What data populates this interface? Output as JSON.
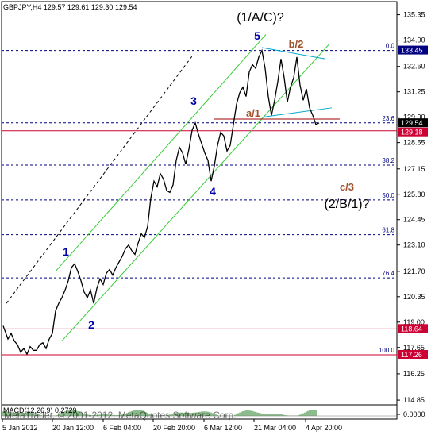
{
  "header": {
    "symbol_line": "GBPJPY,H4  129.57 129.61 129.30 129.54"
  },
  "watermark": "MetaTrader, © 2001-2012, MetaQuotes Software Corp.",
  "indicator_label": "MACD(12,26,9) 0.2729",
  "colors": {
    "background": "#ffffff",
    "price": "#000000",
    "channel": "#33cc33",
    "channel_dashed": "#000000",
    "fib_line": "#000080",
    "red_line": "#cc0033",
    "wave_blue": "#0000aa",
    "wave_brown": "#a0522d",
    "triangle": "#00aacc",
    "price_box_black": "#000000",
    "price_box_red": "#cc0033",
    "price_box_blue": "#000080"
  },
  "chart_data": {
    "type": "line",
    "title": "",
    "price_axis": {
      "labels": [
        "135.35",
        "134.00",
        "132.60",
        "131.25",
        "129.90",
        "128.55",
        "127.15",
        "125.80",
        "124.45",
        "123.10",
        "121.70",
        "120.35",
        "119.00",
        "117.65",
        "116.25",
        "114.85",
        "0.0000"
      ],
      "min": 114.6,
      "max": 136.05
    },
    "time_axis": {
      "labels": [
        "5 Jan 2012",
        "20 Jan 12:00",
        "6 Feb 04:00",
        "20 Feb 20:00",
        "6 Mar 12:00",
        "21 Mar 04:00",
        "4 Apr 20:00"
      ]
    },
    "price_boxes": [
      {
        "value": "133.45",
        "color": "blue"
      },
      {
        "value": "129.54",
        "color": "black"
      },
      {
        "value": "129.18",
        "color": "red"
      },
      {
        "value": "118.64",
        "color": "red"
      },
      {
        "value": "117.26",
        "color": "red"
      }
    ],
    "fib_levels": [
      {
        "label": "0.0",
        "price": 133.45
      },
      {
        "label": "23.6",
        "price": 129.6
      },
      {
        "label": "38.2",
        "price": 127.35
      },
      {
        "label": "50.0",
        "price": 125.5
      },
      {
        "label": "61.8",
        "price": 123.65
      },
      {
        "label": "76.4",
        "price": 121.35
      },
      {
        "label": "100.0",
        "price": 117.26
      }
    ],
    "horizontal_lines": [
      {
        "price": 129.18,
        "color": "red"
      },
      {
        "price": 118.64,
        "color": "red"
      },
      {
        "price": 117.26,
        "color": "red"
      }
    ],
    "wave_labels": [
      {
        "text": "1",
        "color": "blue"
      },
      {
        "text": "2",
        "color": "blue"
      },
      {
        "text": "3",
        "color": "blue"
      },
      {
        "text": "4",
        "color": "blue"
      },
      {
        "text": "5",
        "color": "blue"
      },
      {
        "text": "a/1",
        "color": "brown"
      },
      {
        "text": "b/2",
        "color": "brown"
      },
      {
        "text": "c/3",
        "color": "brown"
      },
      {
        "text": "(1/A/C)?",
        "color": "black"
      },
      {
        "text": "(2/B/1)?",
        "color": "black"
      }
    ],
    "series": [
      {
        "points": [
          [
            0,
            118.8
          ],
          [
            6,
            118.1
          ],
          [
            10,
            118.4
          ],
          [
            14,
            118.0
          ],
          [
            18,
            117.8
          ],
          [
            22,
            117.4
          ],
          [
            26,
            117.6
          ],
          [
            30,
            117.3
          ],
          [
            34,
            117.7
          ],
          [
            38,
            117.5
          ],
          [
            42,
            117.5
          ],
          [
            46,
            117.8
          ],
          [
            50,
            117.9
          ],
          [
            54,
            117.6
          ],
          [
            58,
            118.1
          ],
          [
            62,
            118.4
          ],
          [
            66,
            119.6
          ],
          [
            70,
            120.0
          ],
          [
            74,
            120.3
          ],
          [
            78,
            120.7
          ],
          [
            82,
            121.2
          ],
          [
            86,
            121.9
          ],
          [
            90,
            122.1
          ],
          [
            94,
            121.7
          ],
          [
            98,
            121.2
          ],
          [
            102,
            120.6
          ],
          [
            106,
            120.3
          ],
          [
            110,
            120.7
          ],
          [
            114,
            120.0
          ],
          [
            118,
            120.8
          ],
          [
            122,
            121.3
          ],
          [
            126,
            121.0
          ],
          [
            130,
            121.6
          ],
          [
            134,
            121.8
          ],
          [
            138,
            121.5
          ],
          [
            142,
            121.9
          ],
          [
            146,
            122.2
          ],
          [
            150,
            122.5
          ],
          [
            154,
            122.9
          ],
          [
            158,
            123.1
          ],
          [
            162,
            122.8
          ],
          [
            166,
            122.6
          ],
          [
            170,
            123.2
          ],
          [
            174,
            123.7
          ],
          [
            178,
            123.5
          ],
          [
            182,
            124.1
          ],
          [
            186,
            125.6
          ],
          [
            190,
            126.5
          ],
          [
            194,
            126.2
          ],
          [
            198,
            126.9
          ],
          [
            202,
            126.6
          ],
          [
            206,
            126.0
          ],
          [
            210,
            125.9
          ],
          [
            214,
            126.3
          ],
          [
            218,
            127.6
          ],
          [
            222,
            128.3
          ],
          [
            226,
            128.0
          ],
          [
            230,
            127.4
          ],
          [
            234,
            128.2
          ],
          [
            238,
            129.2
          ],
          [
            242,
            129.6
          ],
          [
            246,
            129.0
          ],
          [
            250,
            128.5
          ],
          [
            254,
            128.0
          ],
          [
            258,
            127.6
          ],
          [
            262,
            126.5
          ],
          [
            266,
            127.3
          ],
          [
            270,
            128.4
          ],
          [
            274,
            129.1
          ],
          [
            278,
            128.9
          ],
          [
            282,
            128.1
          ],
          [
            286,
            128.4
          ],
          [
            290,
            129.5
          ],
          [
            294,
            130.6
          ],
          [
            298,
            131.2
          ],
          [
            302,
            131.5
          ],
          [
            306,
            131.0
          ],
          [
            310,
            132.3
          ],
          [
            314,
            132.7
          ],
          [
            318,
            132.5
          ],
          [
            322,
            133.1
          ],
          [
            326,
            133.45
          ],
          [
            330,
            132.5
          ],
          [
            334,
            131.0
          ],
          [
            338,
            130.0
          ],
          [
            342,
            130.8
          ],
          [
            346,
            131.8
          ],
          [
            350,
            133.0
          ],
          [
            354,
            132.0
          ],
          [
            358,
            130.7
          ],
          [
            362,
            131.5
          ],
          [
            366,
            132.0
          ],
          [
            370,
            133.1
          ],
          [
            374,
            131.6
          ],
          [
            378,
            130.8
          ],
          [
            382,
            131.4
          ],
          [
            386,
            130.4
          ],
          [
            390,
            130.0
          ],
          [
            394,
            129.5
          ],
          [
            398,
            129.6
          ]
        ]
      }
    ],
    "macd": {
      "label": "MACD(12,26,9) 0.2729"
    }
  }
}
